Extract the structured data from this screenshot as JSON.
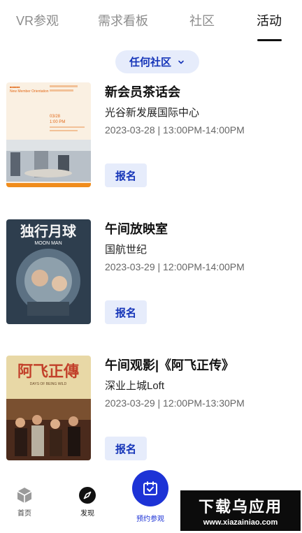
{
  "tabs": [
    {
      "label": "VR参观",
      "active": false
    },
    {
      "label": "需求看板",
      "active": false
    },
    {
      "label": "社区",
      "active": false
    },
    {
      "label": "活动",
      "active": true
    }
  ],
  "filter": {
    "label": "任何社区",
    "icon": "chevron-down-icon"
  },
  "events": [
    {
      "title": "新会员茶话会",
      "venue": "光谷新发展国际中心",
      "time": "2023-03-28 | 13:00PM-14:00PM",
      "button": "报名",
      "poster": {
        "heading": "New Member Orientation",
        "date": "03/28",
        "time": "1:00 PM"
      }
    },
    {
      "title": "午间放映室",
      "venue": "国航世纪",
      "time": "2023-03-29 | 12:00PM-14:00PM",
      "button": "报名",
      "poster": {
        "heading": "独行月球",
        "subheading": "MOON MAN"
      }
    },
    {
      "title": "午间观影|《阿飞正传》",
      "venue": "深业上城Loft",
      "time": "2023-03-29 | 12:00PM-13:30PM",
      "button": "报名",
      "poster": {
        "heading": "阿飞正傳",
        "subheading": "DAYS OF BEING WILD"
      }
    }
  ],
  "bottom_nav": [
    {
      "label": "首页",
      "icon": "cube-icon"
    },
    {
      "label": "发现",
      "icon": "compass-icon"
    },
    {
      "label": "预约参观",
      "icon": "calendar-check-icon"
    }
  ],
  "watermark": {
    "main": "下载乌应用",
    "sub": "www.xiazainiao.com"
  },
  "colors": {
    "accent": "#1d33d6",
    "accent_light": "#e6ecfb",
    "text_muted": "#8d8d8d"
  }
}
